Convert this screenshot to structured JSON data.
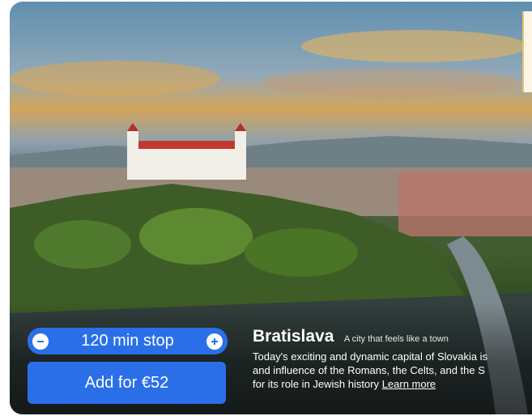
{
  "destination": {
    "name": "Bratislava",
    "tagline": "A city that feels like a town",
    "description_lines": [
      "Today's exciting and dynamic capital of Slovakia is",
      "and influence of the Romans, the Celts, and the S",
      "for its role in Jewish history"
    ],
    "learn_more": "Learn more",
    "image_icon": "bratislava-castle-photo"
  },
  "stop": {
    "label": "120 min stop",
    "minus_icon": "minus-icon",
    "plus_icon": "plus-icon"
  },
  "cta": {
    "label": "Add for €52"
  },
  "colors": {
    "accent": "#2b6fe8",
    "text_on_image": "#ffffff",
    "peek_card": "#fdf6e6"
  }
}
